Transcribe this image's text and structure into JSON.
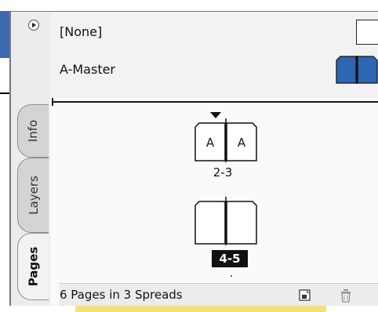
{
  "panel": {
    "tabs": [
      {
        "label": "Info"
      },
      {
        "label": "Layers"
      },
      {
        "label": "Pages"
      }
    ],
    "active_tab": "Pages",
    "masters": [
      {
        "name": "[None]"
      },
      {
        "name": "A-Master"
      }
    ],
    "spreads": [
      {
        "label": "2-3",
        "left_prefix": "A",
        "right_prefix": "A",
        "selected": false
      },
      {
        "label": "4-5",
        "left_prefix": "",
        "right_prefix": "",
        "selected": true
      }
    ],
    "status_text": "6 Pages in 3 Spreads",
    "icons": {
      "menu": "panel-menu-icon",
      "new_page": "new-page-icon",
      "delete": "trash-icon"
    },
    "colors": {
      "master_thumbnail": "#2f66b3",
      "selected_label_bg": "#111111"
    }
  }
}
